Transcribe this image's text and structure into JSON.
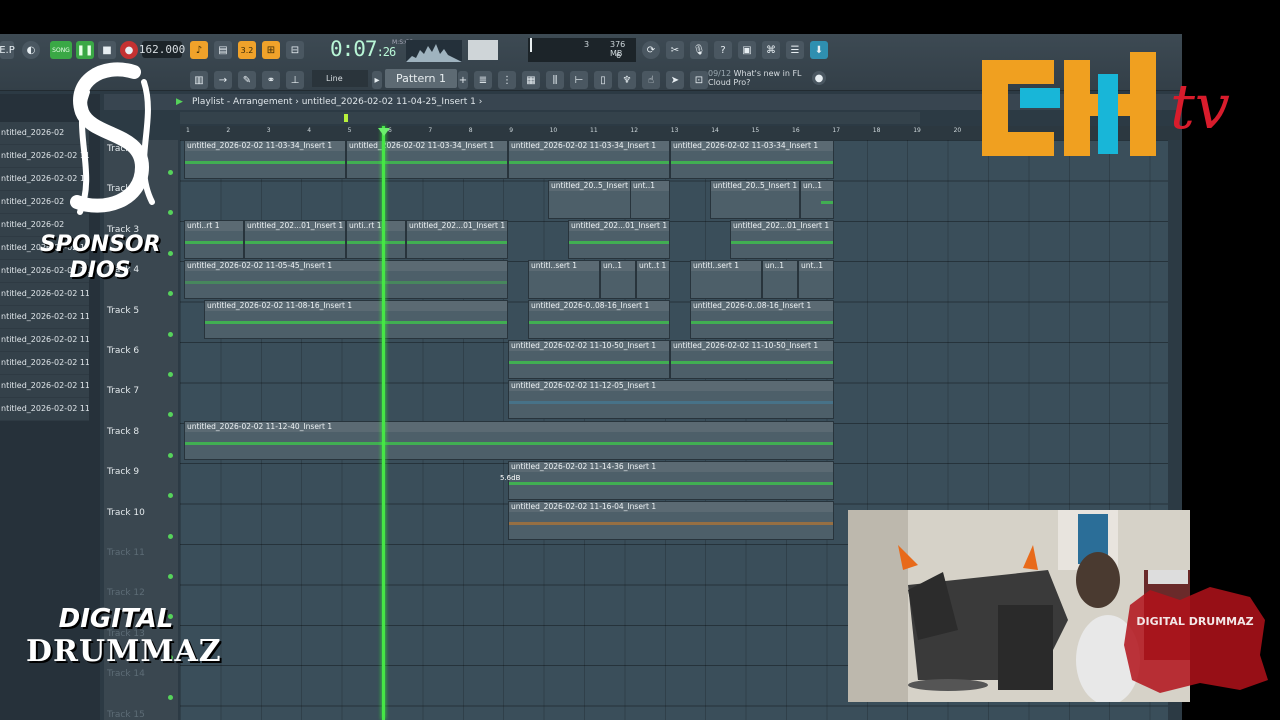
{
  "toolbar": {
    "tempo": "162.000",
    "time_main": "0:07",
    "time_sub": ":26",
    "time_unit": "M:S:CS",
    "cpu_num": "3",
    "mem": "376 MB",
    "mem2": "6",
    "song_label": "SONG",
    "snap": "Line",
    "pattern": "Pattern 1",
    "news_count": "09/12",
    "news_text": "What's new in FL Cloud Pro?",
    "mode_label": "3.2",
    "left_code": "E.P"
  },
  "playlist": {
    "title": "Playlist - Arrangement",
    "breadcrumb": "untitled_2026-02-02 11-04-25_Insert 1",
    "ruler": [
      "1",
      "2",
      "3",
      "4",
      "5",
      "6",
      "7",
      "8",
      "9",
      "10",
      "11",
      "12",
      "13",
      "14",
      "15",
      "16",
      "17",
      "18",
      "19",
      "20"
    ],
    "tracks": [
      "Track 1",
      "Track 2",
      "Track 3",
      "Track 4",
      "Track 5",
      "Track 6",
      "Track 7",
      "Track 8",
      "Track 9",
      "Track 10",
      "Track 11",
      "Track 12",
      "Track 13",
      "Track 14",
      "Track 15"
    ],
    "db_label": "5.6dB"
  },
  "clips": {
    "c1a": "untitled_2026-02-02 11-03-34_Insert 1",
    "c1b": "untitled_2026-02-02 11-03-34_Insert 1",
    "c1c": "untitled_2026-02-02 11-03-34_Insert 1",
    "c1d": "untitled_2026-02-02 11-03-34_Insert 1",
    "c2a": "untitled_20..5_Insert 1",
    "c2b": "unt..1",
    "c2c": "untitled_20..5_Insert 1",
    "c2d": "un..1",
    "c3a": "unti..rt 1",
    "c3b": "untitled_202...01_Insert 1",
    "c3c": "unti..rt 1",
    "c3d": "untitled_202...01_Insert 1",
    "c3e": "untitled_202...01_Insert 1",
    "c3f": "untitled_202...01_Insert 1",
    "c4a": "untitled_2026-02-02 11-05-45_Insert 1",
    "c4b": "untitl..sert 1",
    "c4c": "un..1",
    "c4d": "unt..t 1",
    "c4e": "untitl..sert 1",
    "c4f": "un..1",
    "c4g": "unt..1",
    "c5a": "untitled_2026-02-02 11-08-16_Insert 1",
    "c5b": "untitled_2026-0..08-16_Insert 1",
    "c5c": "untitled_2026-0..08-16_Insert 1",
    "c6a": "untitled_2026-02-02 11-10-50_Insert 1",
    "c6b": "untitled_2026-02-02 11-10-50_Insert 1",
    "c7a": "untitled_2026-02-02 11-12-05_Insert 1",
    "c8a": "untitled_2026-02-02 11-12-40_Insert 1",
    "c9a": "untitled_2026-02-02 11-14-36_Insert 1",
    "c10a": "untitled_2026-02-02 11-16-04_Insert 1"
  },
  "browser": {
    "items": [
      "ntitled_2026-02",
      "ntitled_2026-02-02 11-...",
      "ntitled_2026-02-02 11-...",
      "ntitled_2026-02",
      "ntitled_2026-02",
      "ntitled_2026-02-02 11-...",
      "ntitled_2026-02-02 11-...",
      "ntitled_2026-02-02 11-...",
      "ntitled_2026-02-02 11-...",
      "ntitled_2026-02-02 11-...",
      "ntitled_2026-02-02 11-...",
      "ntitled_2026-02-02 11-...",
      "ntitled_2026-02-02 11-..."
    ]
  },
  "overlay": {
    "sponsor_1": "SPONSOR",
    "sponsor_2": "DIOS",
    "drum_1": "DIGITAL",
    "drum_2": "DRUMMAZ",
    "ehtv_1": "EH",
    "ehtv_2": "tv",
    "stamp": "DIGITAL DRUMMAZ"
  },
  "colors": {
    "accent_orange": "#f0a22a",
    "playhead_green": "#46e646",
    "waveform_green": "#3fc24c",
    "ehtv_orange": "#f0a020",
    "ehtv_cyan": "#18b6d8",
    "ehtv_red": "#d81c2c"
  }
}
